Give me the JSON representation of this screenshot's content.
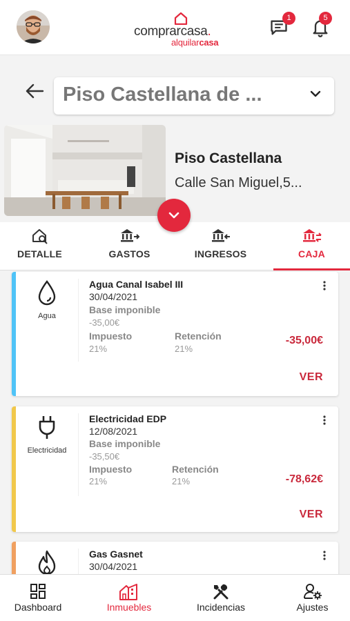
{
  "header": {
    "logo_primary": "comprarcasa",
    "logo_dot": ".",
    "logo_secondary_a": "alquilar",
    "logo_secondary_b": "casa",
    "messages_badge": "1",
    "notifications_badge": "5"
  },
  "property": {
    "selector_text": "Piso Castellana de ...",
    "name": "Piso Castellana",
    "address": "Calle San Miguel,5..."
  },
  "tabs": [
    {
      "label": "DETALLE",
      "icon": "home-search-icon",
      "active": false
    },
    {
      "label": "GASTOS",
      "icon": "bank-out-icon",
      "active": false
    },
    {
      "label": "INGRESOS",
      "icon": "bank-in-icon",
      "active": false
    },
    {
      "label": "CAJA",
      "icon": "bank-swap-icon",
      "active": true
    }
  ],
  "labels": {
    "base": "Base imponible",
    "tax": "Impuesto",
    "retention": "Retención",
    "view": "VER"
  },
  "cards": [
    {
      "category": "Agua",
      "icon": "water-drop-icon",
      "stripe_color": "#4fc3f7",
      "title": "Agua Canal Isabel III",
      "date": "30/04/2021",
      "base": "-35,00€",
      "tax": "21%",
      "retention": "21%",
      "amount": "-35,00€"
    },
    {
      "category": "Electricidad",
      "icon": "plug-icon",
      "stripe_color": "#f1c84b",
      "title": "Electricidad EDP",
      "date": "12/08/2021",
      "base": "-35,50€",
      "tax": "21%",
      "retention": "21%",
      "amount": "-78,62€"
    },
    {
      "category": "Gas",
      "icon": "flame-icon",
      "stripe_color": "#f0a060",
      "title": "Gas Gasnet",
      "date": "30/04/2021"
    }
  ],
  "bottom_nav": [
    {
      "label": "Dashboard",
      "icon": "dashboard-icon",
      "active": false
    },
    {
      "label": "Inmuebles",
      "icon": "buildings-icon",
      "active": true
    },
    {
      "label": "Incidencias",
      "icon": "tools-icon",
      "active": false
    },
    {
      "label": "Ajustes",
      "icon": "user-settings-icon",
      "active": false
    }
  ],
  "colors": {
    "accent": "#e3283d",
    "amount": "#c9283b"
  }
}
